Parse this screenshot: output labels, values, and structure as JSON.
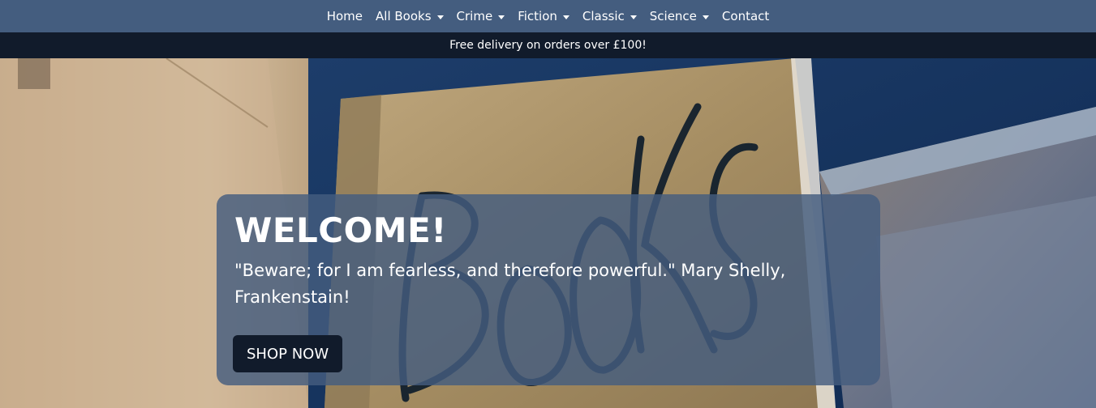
{
  "nav": {
    "items": [
      {
        "label": "Home",
        "dropdown": false
      },
      {
        "label": "All Books",
        "dropdown": true
      },
      {
        "label": "Crime",
        "dropdown": true
      },
      {
        "label": "Fiction",
        "dropdown": true
      },
      {
        "label": "Classic",
        "dropdown": true
      },
      {
        "label": "Science",
        "dropdown": true
      },
      {
        "label": "Contact",
        "dropdown": false
      }
    ]
  },
  "promo": {
    "text": "Free delivery on orders over £100!"
  },
  "hero": {
    "title": "WELCOME!",
    "quote": "\"Beware; for I am fearless, and therefore powerful.\" Mary Shelly, Frankenstain!",
    "cta_label": "SHOP NOW"
  },
  "colors": {
    "nav_bg": "#445d7f",
    "promo_bg": "#111b2b",
    "card_bg": "#445d7f",
    "button_bg": "#111b2b"
  }
}
